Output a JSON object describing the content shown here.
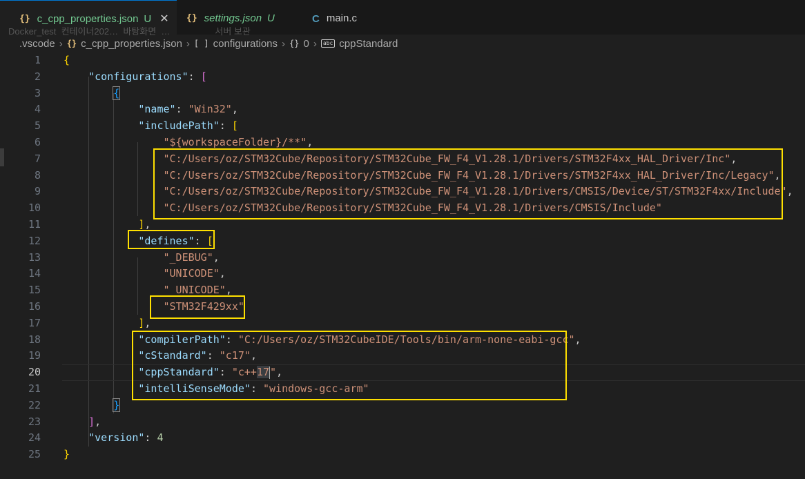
{
  "tabs": [
    {
      "icon": "{}",
      "name": "c_cpp_properties.json",
      "mod": "U",
      "close": "✕"
    },
    {
      "icon": "{}",
      "name": "settings.json",
      "mod": "U"
    },
    {
      "icon": "C",
      "name": "main.c"
    }
  ],
  "ghost_text": "Docker_test  컨테이너202…  바탕화면  …                  서버 보관",
  "breadcrumb": {
    "folder": ".vscode",
    "file_icon": "{}",
    "file": "c_cpp_properties.json",
    "array_icon": "[ ]",
    "array": "configurations",
    "obj_icon": "{}",
    "obj": "0",
    "prop_icon": "abc",
    "prop": "cppStandard"
  },
  "editor": {
    "line_numbers": [
      "1",
      "2",
      "3",
      "4",
      "5",
      "6",
      "7",
      "8",
      "9",
      "10",
      "11",
      "12",
      "13",
      "14",
      "15",
      "16",
      "17",
      "18",
      "19",
      "20",
      "21",
      "22",
      "23",
      "24",
      "25"
    ],
    "current_line": "20",
    "code": {
      "l1_open": "{",
      "l2_key": "\"configurations\"",
      "l2_colon": ": ",
      "l2_open": "[",
      "l3_open": "{",
      "l4_key": "\"name\"",
      "l4_val": "\"Win32\"",
      "l5_key": "\"includePath\"",
      "l5_open": "[",
      "l6_val": "\"${workspaceFolder}/**\"",
      "l7_val": "\"C:/Users/oz/STM32Cube/Repository/STM32Cube_FW_F4_V1.28.1/Drivers/STM32F4xx_HAL_Driver/Inc\"",
      "l8_val": "\"C:/Users/oz/STM32Cube/Repository/STM32Cube_FW_F4_V1.28.1/Drivers/STM32F4xx_HAL_Driver/Inc/Legacy\"",
      "l9_val": "\"C:/Users/oz/STM32Cube/Repository/STM32Cube_FW_F4_V1.28.1/Drivers/CMSIS/Device/ST/STM32F4xx/Include\"",
      "l10_val": "\"C:/Users/oz/STM32Cube/Repository/STM32Cube_FW_F4_V1.28.1/Drivers/CMSIS/Include\"",
      "l11_close": "]",
      "l12_key": "\"defines\"",
      "l12_open": "[",
      "l13_val": "\"_DEBUG\"",
      "l14_val": "\"UNICODE\"",
      "l15_val": "\"_UNICODE\"",
      "l16_val": "\"STM32F429xx\"",
      "l17_close": "]",
      "l18_key": "\"compilerPath\"",
      "l18_val": "\"C:/Users/oz/STM32CubeIDE/Tools/bin/arm-none-eabi-gcc\"",
      "l19_key": "\"cStandard\"",
      "l19_val": "\"c17\"",
      "l20_key": "\"cppStandard\"",
      "l20_val_a": "\"c++",
      "l20_val_b": "17",
      "l20_val_c": "\"",
      "l21_key": "\"intelliSenseMode\"",
      "l21_val": "\"windows-gcc-arm\"",
      "l22_close": "}",
      "l23_close": "]",
      "l24_key": "\"version\"",
      "l24_val": "4",
      "l25_close": "}",
      "comma": ",",
      "colon": ": "
    }
  },
  "colors": {
    "key": "#9cdcfe",
    "string": "#ce9178",
    "number": "#b5cea8",
    "highlight_box": "#ffe000",
    "modified": "#73c991"
  }
}
